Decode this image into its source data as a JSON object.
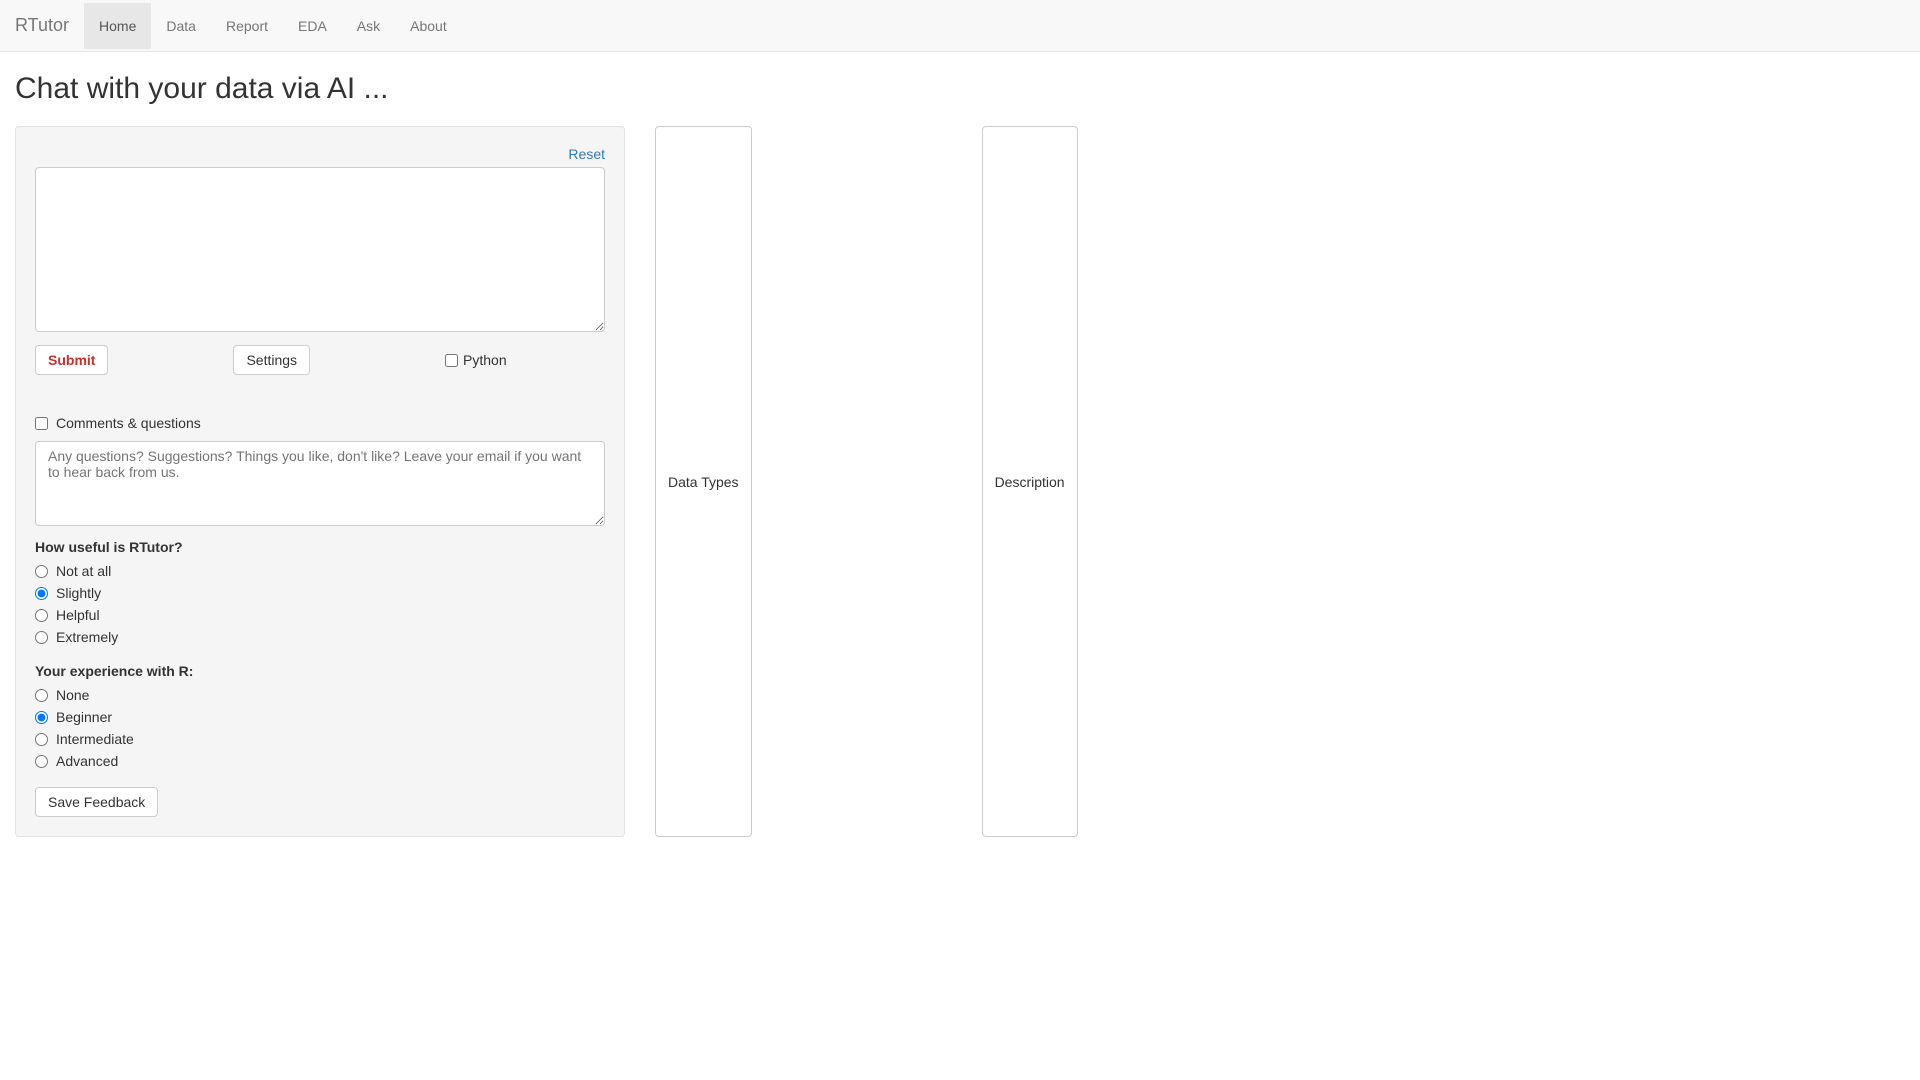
{
  "navbar": {
    "brand": "RTutor",
    "tabs": [
      {
        "label": "Home",
        "active": true
      },
      {
        "label": "Data",
        "active": false
      },
      {
        "label": "Report",
        "active": false
      },
      {
        "label": "EDA",
        "active": false
      },
      {
        "label": "Ask",
        "active": false
      },
      {
        "label": "About",
        "active": false
      }
    ]
  },
  "heading": "Chat with your data via AI ...",
  "panel": {
    "reset_label": "Reset",
    "main_input_value": "",
    "submit_label": "Submit",
    "settings_label": "Settings",
    "python_label": "Python",
    "python_checked": false,
    "comments_label": "Comments & questions",
    "comments_checked": false,
    "feedback_placeholder": "Any questions? Suggestions? Things you like, don't like? Leave your email if you want to hear back from us.",
    "feedback_value": "",
    "useful_label": "How useful is RTutor?",
    "useful_options": [
      {
        "label": "Not at all",
        "checked": false
      },
      {
        "label": "Slightly",
        "checked": true
      },
      {
        "label": "Helpful",
        "checked": false
      },
      {
        "label": "Extremely",
        "checked": false
      }
    ],
    "experience_label": "Your experience with R:",
    "experience_options": [
      {
        "label": "None",
        "checked": false
      },
      {
        "label": "Beginner",
        "checked": true
      },
      {
        "label": "Intermediate",
        "checked": false
      },
      {
        "label": "Advanced",
        "checked": false
      }
    ],
    "save_feedback_label": "Save Feedback"
  },
  "right": {
    "data_types_label": "Data Types",
    "description_label": "Description"
  }
}
